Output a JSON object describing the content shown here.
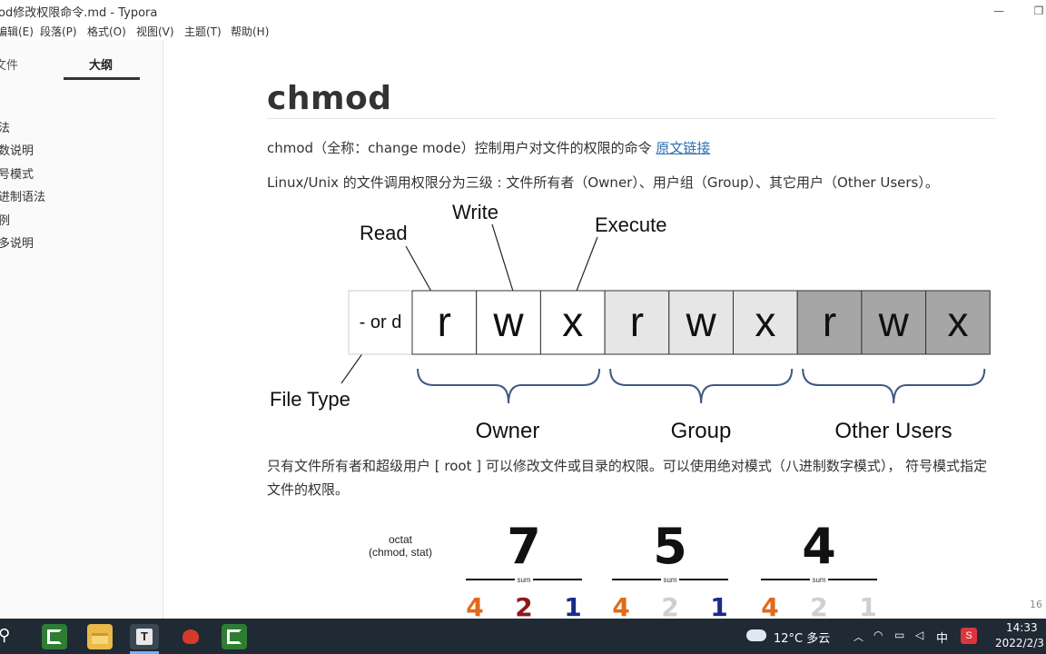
{
  "window": {
    "title": "od修改权限命令.md - Typora",
    "minimize_glyph": "—",
    "restore_glyph": "❐"
  },
  "menu": {
    "items": [
      "编辑(E)",
      "段落(P)",
      "格式(O)",
      "视图(V)",
      "主题(T)",
      "帮助(H)"
    ]
  },
  "sidebar": {
    "tabs": [
      "文件",
      "大纲"
    ],
    "active_tab": "大纲",
    "outline": [
      "法",
      "数说明",
      "号模式",
      "进制语法",
      "例",
      "多说明"
    ],
    "footer": {
      "back_glyph": "‹",
      "source_glyph": "</>"
    }
  },
  "document": {
    "heading": "chmod",
    "p1_text": "chmod（全称：change mode）控制用户对文件的权限的命令 ",
    "p1_link": "原文链接",
    "p2": "Linux/Unix 的文件调用权限分为三级 : 文件所有者（Owner）、用户组（Group）、其它用户（Other Users）。",
    "p3": "只有文件所有者和超级用户 [ root ] 可以修改文件或目录的权限。可以使用绝对模式（八进制数字模式）， 符号模式指定文件的权限。",
    "line_count": "16"
  },
  "permission_diagram": {
    "top_labels": [
      "Read",
      "Write",
      "Execute"
    ],
    "type_cell": "- or d",
    "type_label": "File Type",
    "cells": [
      "r",
      "w",
      "x",
      "r",
      "w",
      "x",
      "r",
      "w",
      "x"
    ],
    "groups": [
      "Owner",
      "Group",
      "Other Users"
    ],
    "group_colors": [
      "#ffffff",
      "#e6e6e6",
      "#a6a6a6"
    ],
    "brace_color": "#3d5a80"
  },
  "octal_diagram": {
    "caption_line1": "octat",
    "caption_line2": "(chmod, stat)",
    "digits": [
      "7",
      "5",
      "4"
    ],
    "sum_label": "sum",
    "bits": [
      [
        "4",
        "2",
        "1"
      ],
      [
        "4",
        "2",
        "1"
      ],
      [
        "4",
        "2",
        "1"
      ]
    ],
    "bit_colors": [
      "#e06a1b",
      "#8a1b1b",
      "#1b2a8a"
    ],
    "inactive_color": "#cfcfcf"
  },
  "taskbar": {
    "weather": "12°C  多云",
    "ime": "中",
    "time": "14:33",
    "date": "2022/2/3",
    "search_glyph": "⚲"
  }
}
